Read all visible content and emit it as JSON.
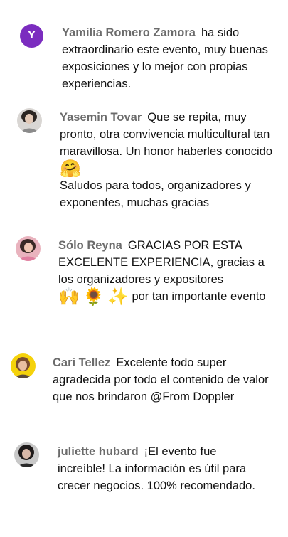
{
  "comments": [
    {
      "author": "Yamilia Romero Zamora",
      "avatar_letter": "Y",
      "text": "ha sido extraordinario este evento, muy buenas exposiciones y lo mejor con propias experiencias."
    },
    {
      "author": "Yasemin Tovar",
      "text_before_emoji": "Que se repita, muy pronto, otra convivencia multicultural tan maravillosa. Un honor haberles conocido",
      "emoji": "🤗",
      "text_after_emoji": "Saludos para todos, organizadores y exponentes, muchas gracias"
    },
    {
      "author": "Sólo Reyna",
      "text_before_emoji": "GRACIAS POR ESTA EXCELENTE EXPERIENCIA, gracias a los organizadores y expositores",
      "emojis": [
        "🙌",
        "🌻",
        "✨"
      ],
      "text_after_emoji": "por tan importante evento"
    },
    {
      "author": "Cari Tellez",
      "text": "Excelente todo super agradecida por todo el contenido de valor que nos brindaron @From Doppler"
    },
    {
      "author": "juliette hubard",
      "text": "¡El evento fue increíble! La información es útil para crecer negocios. 100% recomendado."
    }
  ]
}
